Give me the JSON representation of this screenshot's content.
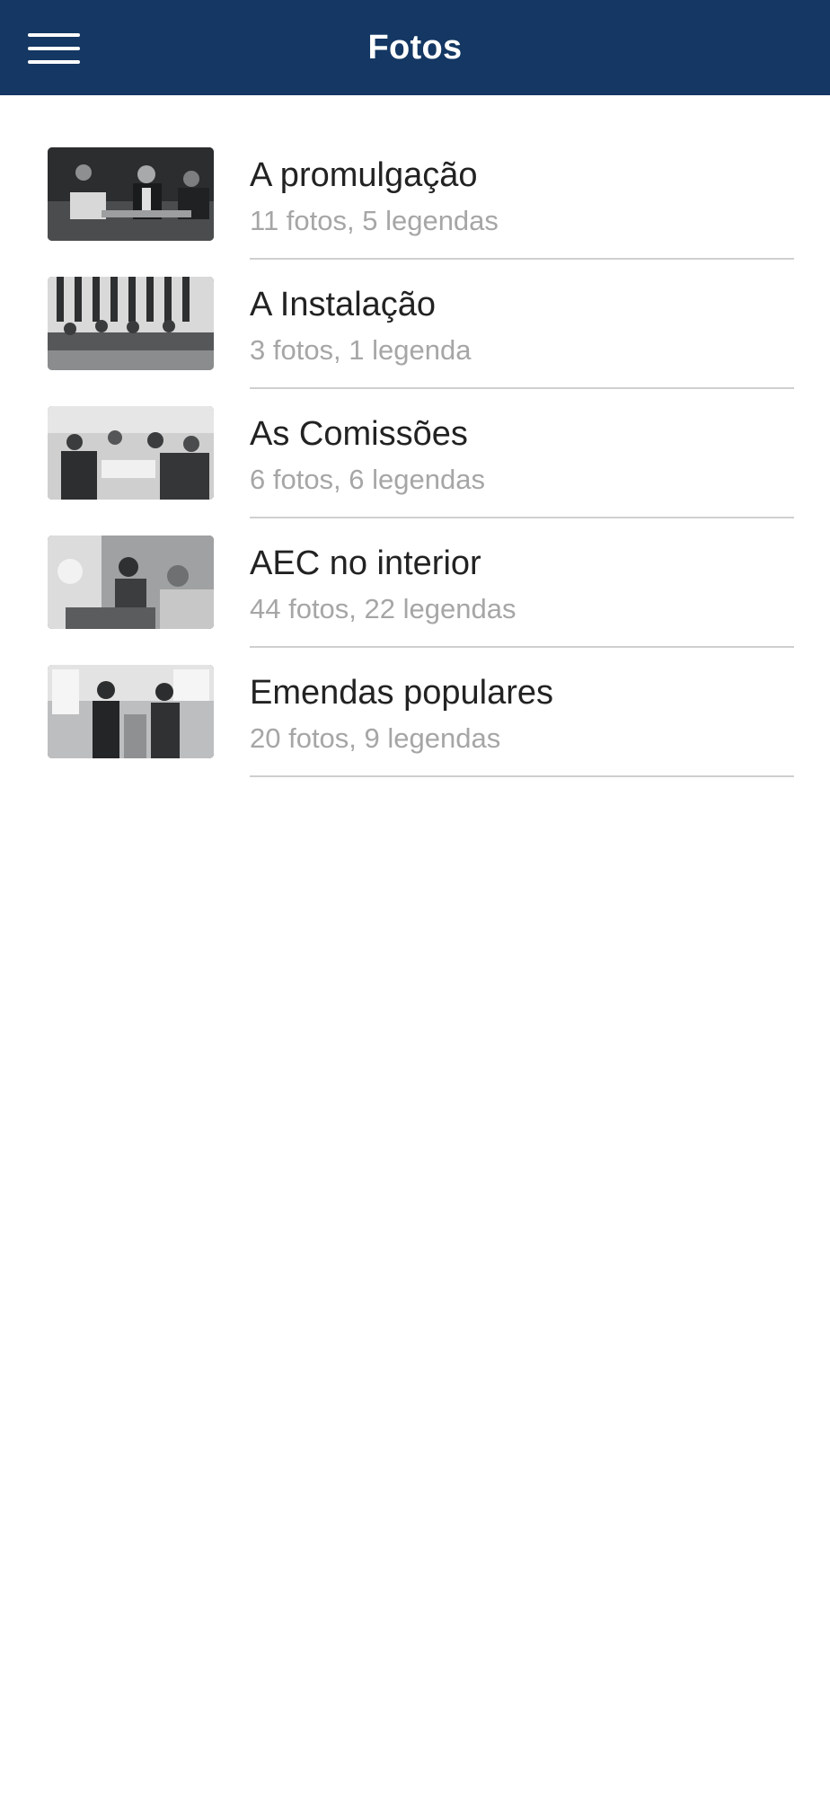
{
  "header": {
    "title": "Fotos",
    "background": "#143763",
    "menu_icon": "hamburger-menu-icon"
  },
  "albums": [
    {
      "title": "A promulgação",
      "meta": "11 fotos, 5 legendas"
    },
    {
      "title": "A Instalação",
      "meta": "3 fotos, 1 legenda"
    },
    {
      "title": "As Comissões",
      "meta": "6 fotos, 6 legendas"
    },
    {
      "title": "AEC no interior",
      "meta": "44 fotos, 22 legendas"
    },
    {
      "title": "Emendas populares",
      "meta": "20 fotos, 9 legendas"
    }
  ],
  "colors": {
    "title_text": "#222222",
    "meta_text": "#a6a6a6",
    "divider": "#cfcfcf"
  }
}
